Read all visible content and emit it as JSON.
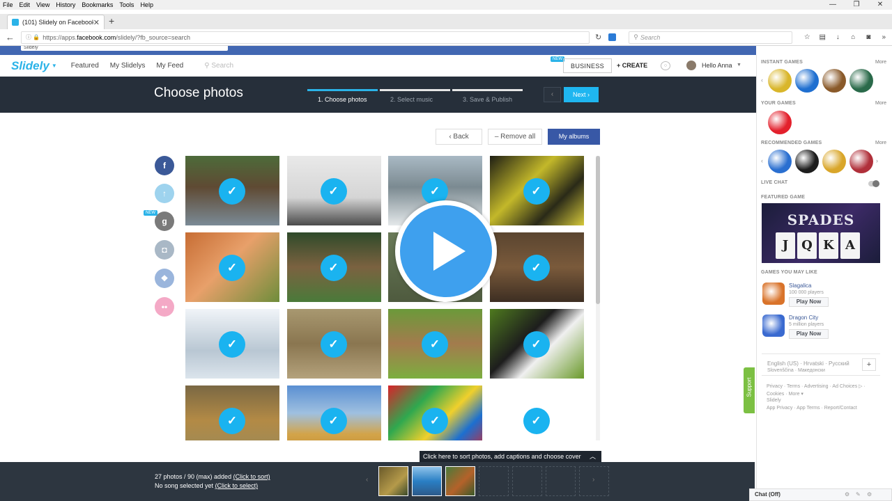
{
  "browser": {
    "menu": [
      "File",
      "Edit",
      "View",
      "History",
      "Bookmarks",
      "Tools",
      "Help"
    ],
    "tab_title": "(101) Slidely on Facebook",
    "url_prefix": "https://apps.",
    "url_domain": "facebook.com",
    "url_rest": "/slidely/?fb_source=search",
    "search_placeholder": "Search"
  },
  "fb": {
    "search_value": "Slidely"
  },
  "header": {
    "logo": "Slidely",
    "nav": [
      "Featured",
      "My Slidelys",
      "My Feed"
    ],
    "search_placeholder": "Search",
    "new_badge": "NEW",
    "business": "BUSINESS",
    "create": "+ CREATE",
    "user": "Hello Anna"
  },
  "stepbar": {
    "title": "Choose photos",
    "steps": [
      "1. Choose photos",
      "2. Select music",
      "3. Save & Publish"
    ],
    "active_step": 0,
    "prev": "‹",
    "next": "Next ›"
  },
  "toolbar": {
    "back": "‹  Back",
    "remove_all": "– Remove all",
    "my_albums": "My albums"
  },
  "sources": [
    {
      "name": "facebook",
      "glyph": "f",
      "color": "#3b5998"
    },
    {
      "name": "upload",
      "glyph": "↑",
      "color": "#9ed3ee"
    },
    {
      "name": "google",
      "glyph": "g",
      "color": "#7a7a7a"
    },
    {
      "name": "instagram",
      "glyph": "◘",
      "color": "#a9b8c6"
    },
    {
      "name": "dropbox",
      "glyph": "❖",
      "color": "#9ab5dc"
    },
    {
      "name": "flickr",
      "glyph": "••",
      "color": "#f4a9c6"
    }
  ],
  "sources_new_badge": "NEW",
  "photos": [
    {
      "subject": "brown bear by river",
      "bg": "linear-gradient(180deg,#4d6b3a 0%,#5f4a33 45%,#7a8a96 100%)"
    },
    {
      "subject": "rabbit and cat",
      "bg": "linear-gradient(180deg,#e9e9e9 0%,#d5d5d5 60%,#4a4a4a 100%)"
    },
    {
      "subject": "reindeer in snow",
      "bg": "linear-gradient(180deg,#a9b9c4 0%,#7b8a91 45%,#e4e8ea 100%)"
    },
    {
      "subject": "yellow-black frog",
      "bg": "linear-gradient(135deg,#1e1e14 0%,#c3b82a 40%,#2a2a18 70%,#d6c93a 100%)"
    },
    {
      "subject": "red fox",
      "bg": "linear-gradient(135deg,#c76d34 0%,#e8a06a 45%,#6e8d3b 100%)"
    },
    {
      "subject": "lion on grass",
      "bg": "linear-gradient(180deg,#2f4a2a 0%,#7b6240 50%,#4a7a3a 100%)"
    },
    {
      "subject": "animal",
      "bg": "linear-gradient(180deg,#6a7a58 0%,#4e5a3e 100%)"
    },
    {
      "subject": "bear face",
      "bg": "linear-gradient(180deg,#5a4530 0%,#7a5a3b 50%,#3d2e22 100%)"
    },
    {
      "subject": "penguin",
      "bg": "linear-gradient(180deg,#f0f4f8 0%,#b9c7d3 60%,#dbe4ec 100%)"
    },
    {
      "subject": "lions in grass",
      "bg": "linear-gradient(180deg,#a89870 0%,#8a7650 50%,#b4a27c 100%)"
    },
    {
      "subject": "two rabbits",
      "bg": "linear-gradient(180deg,#6b9a3a 0%,#a37b4d 50%,#7cae3f 100%)"
    },
    {
      "subject": "panda",
      "bg": "linear-gradient(135deg,#4e7a1e 0%,#1d1d1d 40%,#f0f0f0 60%,#6a9a2a 100%)"
    },
    {
      "subject": "lion lying",
      "bg": "linear-gradient(180deg,#7a6844 0%,#b38a45 50%,#9a8a5a 100%)"
    },
    {
      "subject": "cheetah running",
      "bg": "linear-gradient(180deg,#5a8fd2 0%,#9fc0e0 40%,#d3a449 70%,#c18c35 100%)"
    },
    {
      "subject": "colorful abstract",
      "bg": "linear-gradient(135deg,#d8232a 0%,#2fa84f 30%,#f0d02c 55%,#1c6fd0 75%,#d8232a 100%)"
    },
    {
      "subject": "logo image",
      "bg": "linear-gradient(180deg,#ffffff 0%,#ffffff 100%)"
    }
  ],
  "photo_check_glyph": "✓",
  "sort_tip": "Click here to sort photos, add captions and choose cover",
  "bottom": {
    "photos_text": "27 photos / 90 (max) added ",
    "photos_link": "(Click to sort)",
    "song_text": "No song selected yet ",
    "song_link": "(Click to select)",
    "thumbs": [
      "linear-gradient(135deg,#6a5a2a 0%,#b59a4a 60%,#3a4a2a 100%)",
      "linear-gradient(180deg,#8fc3ea 0%,#2a7fc4 50%,#2d5a8a 100%)",
      "linear-gradient(135deg,#4a7a3a 0%,#b4622a 55%,#3a5a2a 100%)"
    ]
  },
  "sidebar": {
    "instant_games": "INSTANT GAMES",
    "your_games": "YOUR GAMES",
    "recommended": "RECOMMENDED GAMES",
    "live_chat": "LIVE CHAT",
    "featured_game": "FEATURED GAME",
    "games_you_may_like": "GAMES YOU MAY LIKE",
    "more": "More",
    "instant_colors": [
      "#d9b62a",
      "#1f6fd0",
      "#8a5a2a",
      "#2a6a4a"
    ],
    "your_colors": [
      "#e3202c"
    ],
    "recommended_colors": [
      "#2a6fd0",
      "#1d1d1d",
      "#d9a62a",
      "#b0303a"
    ],
    "featured_title": "SPADES",
    "featured_cards": [
      "J",
      "Q",
      "K",
      "A"
    ],
    "games": [
      {
        "name": "Slagalica",
        "players": "100 000 players",
        "color": "#d9732a"
      },
      {
        "name": "Dragon City",
        "players": "5 million players",
        "color": "#3a6ad0"
      }
    ],
    "play_now": "Play Now",
    "lang_main": "English (US)",
    "lang_others_1": "Hrvatski · Русский",
    "lang_others_2": "Slovenščina · Македонски",
    "footer": [
      "Privacy · Terms · Advertising · Ad Choices ▷ ·",
      "Cookies · More ▾",
      "Slidely",
      "App Privacy · App Terms · Report/Contact"
    ],
    "support": "Support",
    "chat": "Chat (Off)"
  }
}
